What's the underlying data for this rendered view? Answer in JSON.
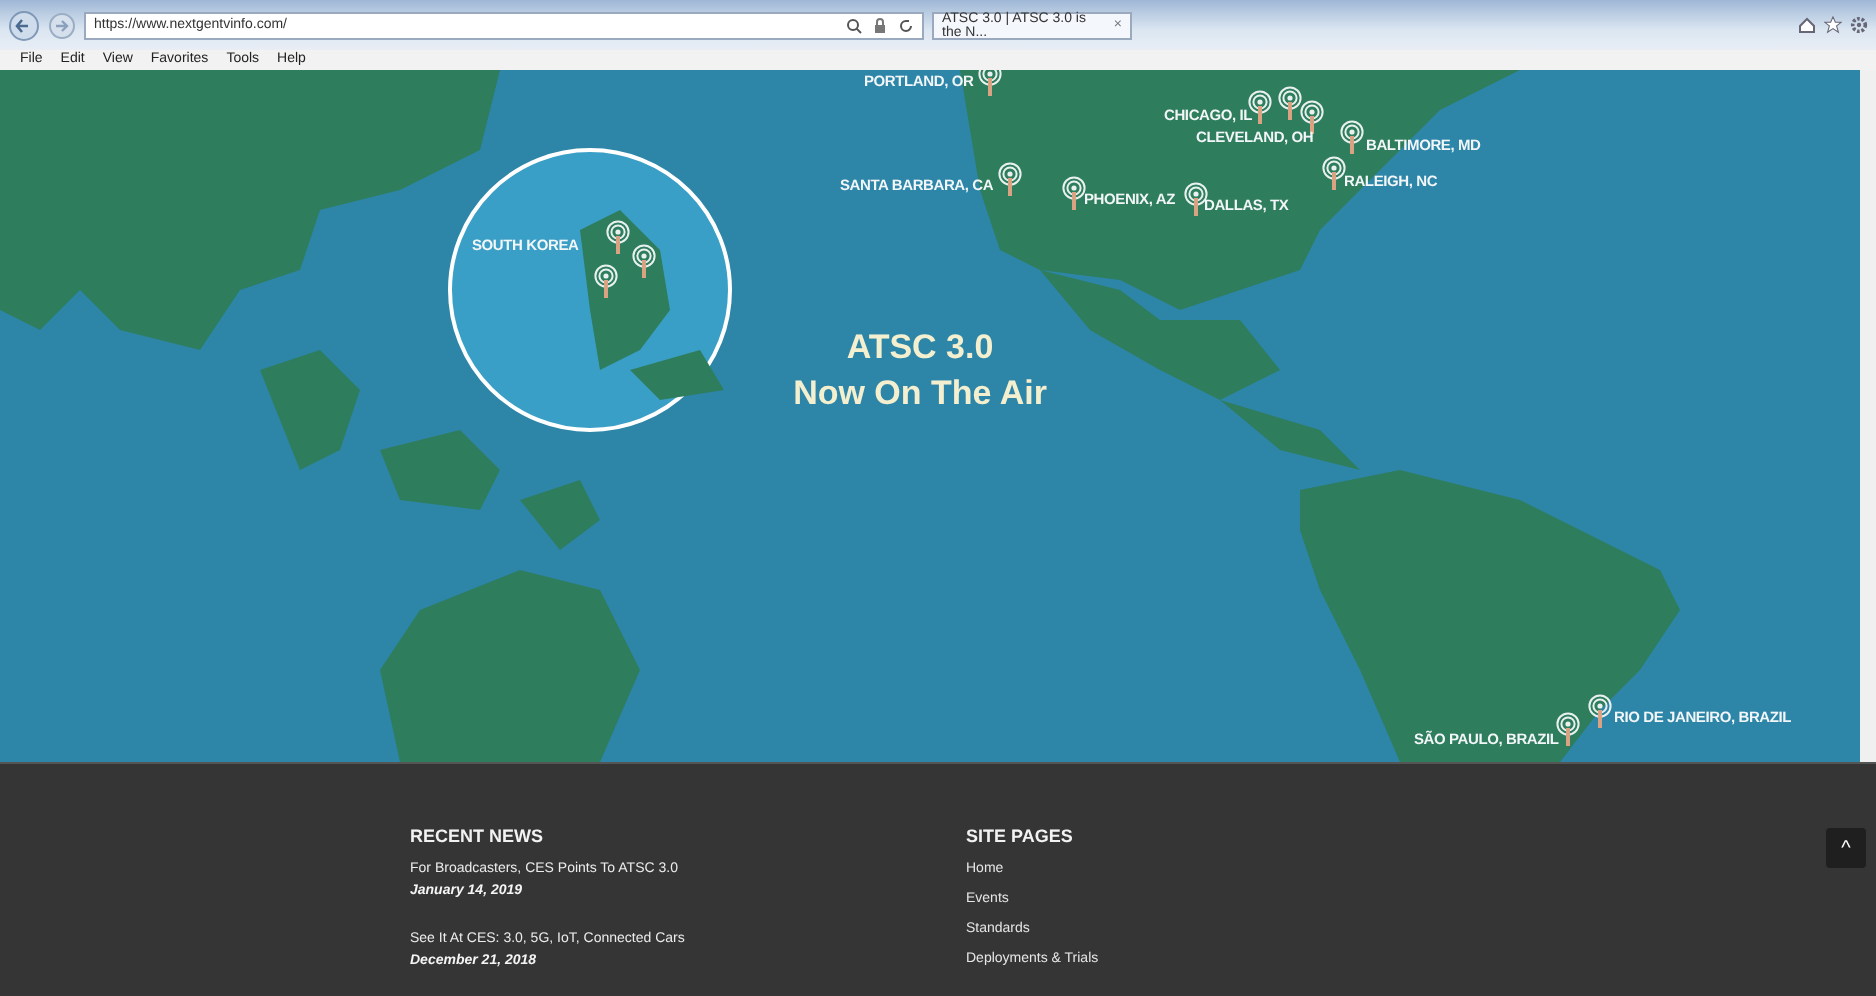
{
  "browser": {
    "url": "https://www.nextgentvinfo.com/",
    "tab_title": "ATSC 3.0 | ATSC 3.0 is the N...",
    "tab_close": "×",
    "menu": [
      "File",
      "Edit",
      "View",
      "Favorites",
      "Tools",
      "Help"
    ]
  },
  "map": {
    "headline": "ATSC 3.0",
    "subheadline": "Now On The Air",
    "inset_label": "SOUTH KOREA",
    "locations": [
      {
        "label": "PORTLAND, OR"
      },
      {
        "label": "CHICAGO, IL"
      },
      {
        "label": "CLEVELAND, OH"
      },
      {
        "label": "BALTIMORE, MD"
      },
      {
        "label": "SANTA BARBARA, CA"
      },
      {
        "label": "PHOENIX, AZ"
      },
      {
        "label": "DALLAS, TX"
      },
      {
        "label": "RALEIGH, NC"
      },
      {
        "label": "SÃO PAULO, BRAZIL"
      },
      {
        "label": "RIO DE JANEIRO, BRAZIL"
      }
    ]
  },
  "footer": {
    "recent_news": {
      "heading": "RECENT NEWS",
      "items": [
        {
          "title": "For Broadcasters, CES Points To ATSC 3.0",
          "date": "January 14, 2019"
        },
        {
          "title": "See It At CES: 3.0, 5G, IoT, Connected Cars",
          "date": "December 21, 2018"
        }
      ]
    },
    "site_pages": {
      "heading": "SITE PAGES",
      "links": [
        "Home",
        "Events",
        "Standards",
        "Deployments & Trials"
      ]
    },
    "back_to_top": "^"
  }
}
